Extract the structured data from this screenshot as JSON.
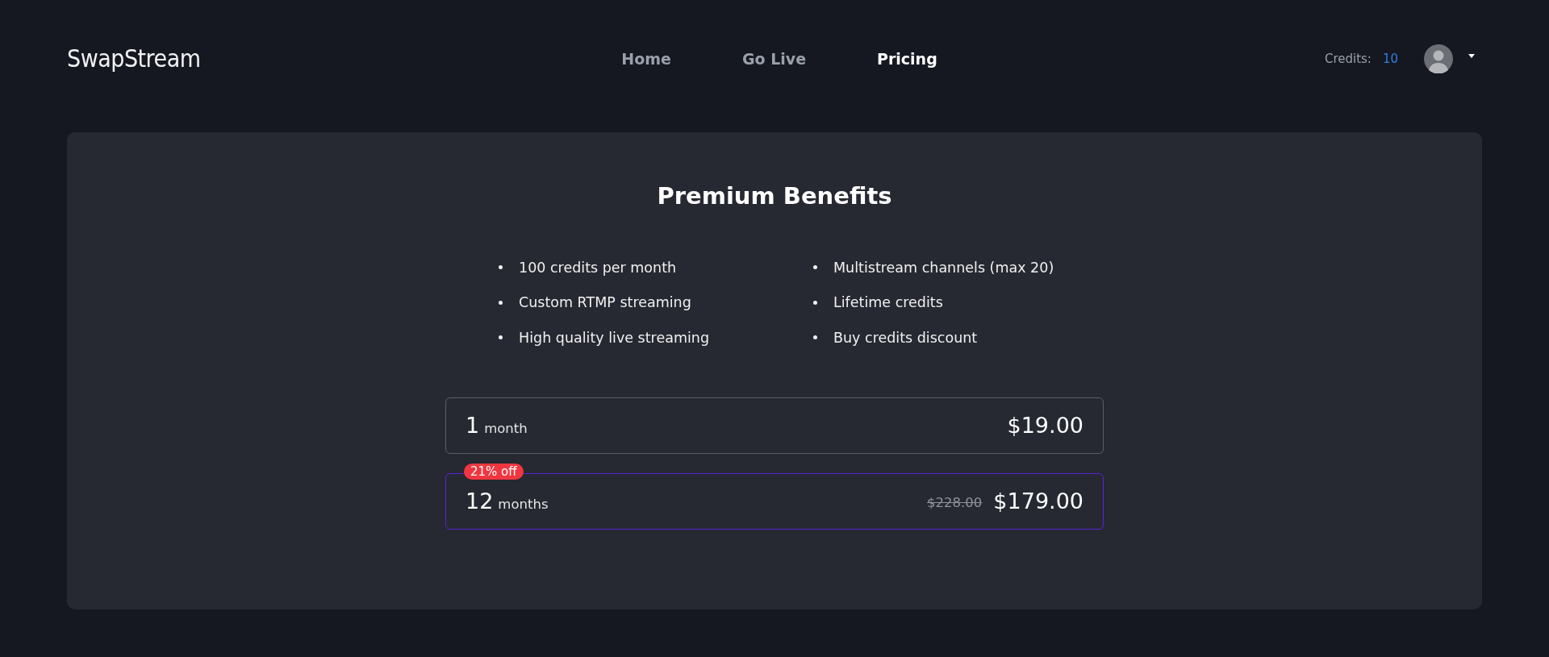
{
  "header": {
    "logo": "SwapStream",
    "nav": [
      {
        "label": "Home",
        "selected": false
      },
      {
        "label": "Go Live",
        "selected": false
      },
      {
        "label": "Pricing",
        "selected": true
      }
    ],
    "credits_label": "Credits:",
    "credits_value": "10"
  },
  "pricing": {
    "title": "Premium Benefits",
    "benefits": [
      [
        "100 credits per month",
        "Custom RTMP streaming",
        "High quality live streaming"
      ],
      [
        "Multistream channels (max 20)",
        "Lifetime credits",
        "Buy credits discount"
      ]
    ],
    "plans": [
      {
        "count": "1",
        "unit": "month",
        "price": "$19.00",
        "selected": false
      },
      {
        "count": "12",
        "unit": "months",
        "badge": "21% off",
        "old_price": "$228.00",
        "price": "$179.00",
        "selected": true
      }
    ]
  }
}
